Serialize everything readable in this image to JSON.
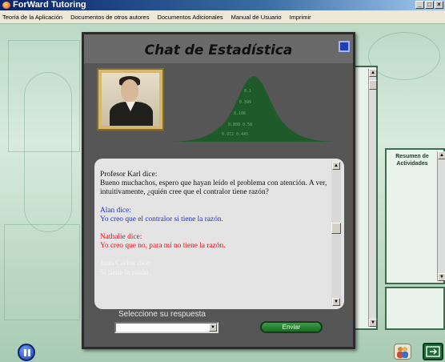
{
  "window": {
    "title": "ForWard Tutoring",
    "controls": [
      "_",
      "□",
      "×"
    ]
  },
  "menu": [
    "Teoría de la Aplicación",
    "Documentos de otros autores",
    "Documentos Adicionales",
    "Manual de Usuario",
    "Imprimir"
  ],
  "side_panel": {
    "title_line1": "Resumen de",
    "title_line2": "Actividades"
  },
  "chat": {
    "title": "Chat de Estadística",
    "messages": [
      {
        "speaker": "Profesor Karl dice:",
        "text": "Bueno muchachos, espero que hayan leído el problema con atención. A ver, intuitivamente, ¿quién cree que el contralor tiene razón?",
        "color": "#111111"
      },
      {
        "speaker": "Alan dice:",
        "text": "Yo creo que el contralor si tiene la razón.",
        "color": "#2233c8"
      },
      {
        "speaker": "Nathalie dice:",
        "text": "Yo creo que no, para mí no tiene la razón.",
        "color": "#e0141a"
      },
      {
        "speaker": "Juan Carlos dice:",
        "text": "Sí tiene la razón",
        "color": "#f4f4f4"
      }
    ],
    "prompt": "Seleccione su respuesta",
    "select_value": "",
    "send_label": "Enviar"
  },
  "colors": {
    "dialog_bg": "#565656",
    "curve": "#1f5a2a",
    "accent_blue": "#1e3fb5"
  },
  "icons": [
    "app-icon",
    "close-icon",
    "dropdown-arrow-icon",
    "pause-icon",
    "people-icon",
    "exit-icon"
  ]
}
